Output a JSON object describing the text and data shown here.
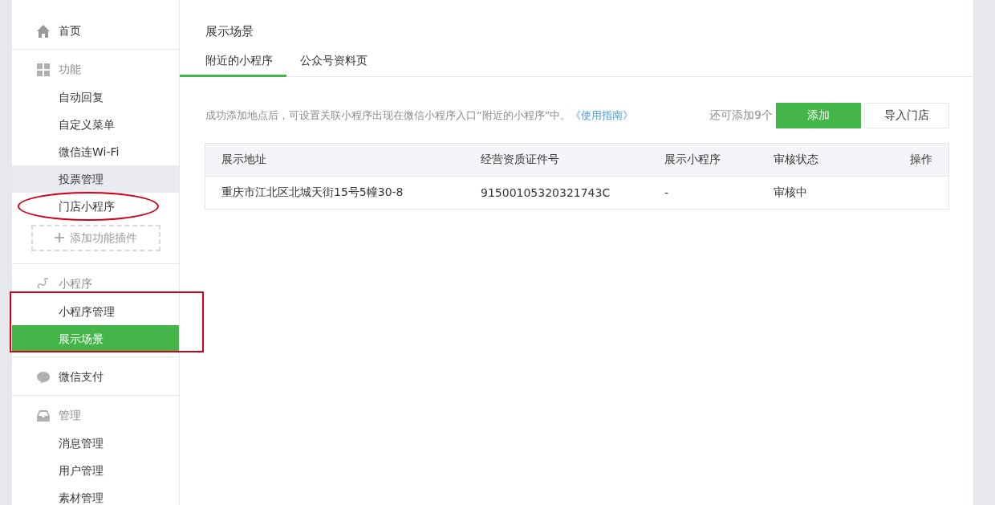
{
  "sidebar": {
    "sections": [
      {
        "kind": "home",
        "title": "首页"
      },
      {
        "kind": "grid",
        "title": "功能",
        "items": [
          {
            "label": "自动回复",
            "selected": false,
            "hovered": false,
            "circled": false
          },
          {
            "label": "自定义菜单",
            "selected": false,
            "hovered": false,
            "circled": false
          },
          {
            "label": "微信连Wi-Fi",
            "selected": false,
            "hovered": false,
            "circled": false
          },
          {
            "label": "投票管理",
            "selected": false,
            "hovered": true,
            "circled": false
          },
          {
            "label": "门店小程序",
            "selected": false,
            "hovered": false,
            "circled": true
          }
        ],
        "add_button": "添加功能插件",
        "boxed": false
      },
      {
        "kind": "link",
        "title": "小程序",
        "items": [
          {
            "label": "小程序管理",
            "selected": false,
            "hovered": false,
            "circled": false
          },
          {
            "label": "展示场景",
            "selected": true,
            "hovered": false,
            "circled": false
          }
        ],
        "boxed": true
      },
      {
        "kind": "pay",
        "title": "微信支付"
      },
      {
        "kind": "inbox",
        "title": "管理",
        "items": [
          {
            "label": "消息管理",
            "selected": false,
            "hovered": false,
            "circled": false
          },
          {
            "label": "用户管理",
            "selected": false,
            "hovered": false,
            "circled": false
          },
          {
            "label": "素材管理",
            "selected": false,
            "hovered": false,
            "circled": false
          }
        ],
        "boxed": false
      }
    ]
  },
  "main": {
    "title": "展示场景",
    "tabs": [
      {
        "label": "附近的小程序",
        "selected": true
      },
      {
        "label": "公众号资料页",
        "selected": false
      }
    ],
    "notice": "成功添加地点后，可设置关联小程序出现在微信小程序入口“附近的小程序”中。",
    "guide_link": "《使用指南》",
    "remaining": "还可添加9个",
    "buttons": [
      {
        "label": "添加",
        "kind": "primary"
      },
      {
        "label": "导入门店",
        "kind": "default"
      }
    ],
    "table": {
      "columns": [
        "展示地址",
        "经营资质证件号",
        "展示小程序",
        "审核状态",
        "操作"
      ],
      "rows": [
        [
          "重庆市江北区北城天街15号5幢30-8",
          "91500105320321743C",
          "-",
          "审核中"
        ]
      ]
    }
  }
}
